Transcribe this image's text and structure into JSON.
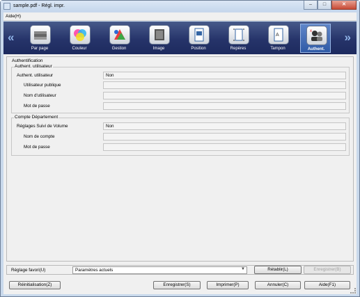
{
  "window": {
    "title": "sample.pdf - Régl. impr.",
    "minimize": "–",
    "maximize": "□",
    "close": "✕"
  },
  "menu": {
    "help": "Aide(H)"
  },
  "toolbar": {
    "tabs": [
      {
        "label": "Par page",
        "icon": "stacked-pages-icon"
      },
      {
        "label": "Couleur",
        "icon": "color-wheel-icon"
      },
      {
        "label": "Gestion",
        "icon": "color-gestion-icon"
      },
      {
        "label": "Image",
        "icon": "image-square-icon"
      },
      {
        "label": "Position",
        "icon": "position-page-icon"
      },
      {
        "label": "Repères",
        "icon": "crop-marks-icon"
      },
      {
        "label": "Tampon",
        "icon": "stamp-page-icon"
      },
      {
        "label": "Authent.",
        "icon": "users-auth-icon",
        "active": true
      }
    ],
    "prev": "«",
    "next": "»"
  },
  "auth": {
    "title": "Authentification",
    "user_auth": {
      "title": "Authent. utilisateur",
      "rows": [
        {
          "label": "Authent. utilisateur",
          "value": "Non"
        },
        {
          "label": "Utilisateur publique",
          "value": ""
        },
        {
          "label": "Nom d'utilisateur",
          "value": ""
        },
        {
          "label": "Mot de passe",
          "value": ""
        }
      ]
    },
    "department": {
      "title": "Compte Département",
      "rows": [
        {
          "label": "Réglages Suivi de Volume",
          "value": "Non"
        },
        {
          "label": "Nom de compte",
          "value": ""
        },
        {
          "label": "Mot de passe",
          "value": ""
        }
      ]
    }
  },
  "favorites": {
    "label": "Réglage favori(U)",
    "selected": "Paramètres actuels",
    "restore": "Rétablir(L)",
    "save": "Enregistrer(B)"
  },
  "buttons": {
    "reset": "Réinitialisation(Z)",
    "save": "Enregistrer(S)",
    "print": "Imprimer(P)",
    "cancel": "Annuler(C)",
    "help": "Aide(F1)"
  },
  "colors": {
    "toolbar": "#26346a",
    "active_tab": "#3b66b0",
    "panel": "#f0f0f0"
  }
}
